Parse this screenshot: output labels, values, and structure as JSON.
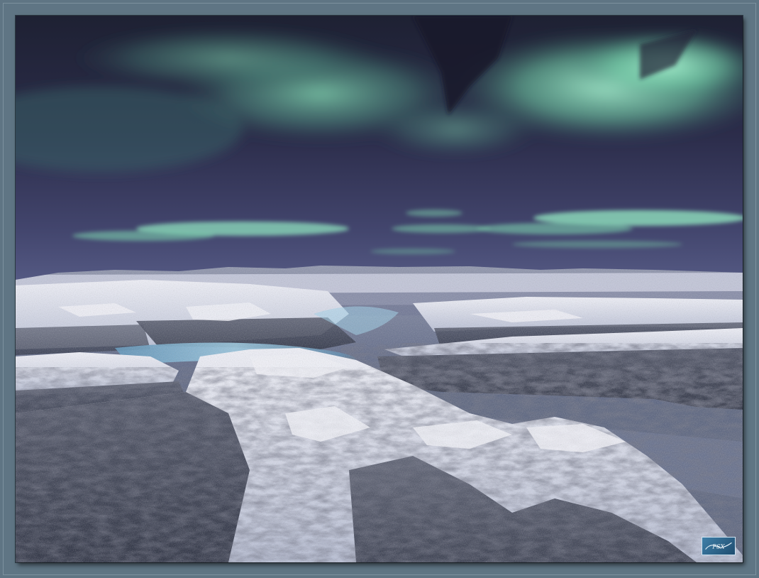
{
  "artwork": {
    "signature": "PSX"
  },
  "colors": {
    "frame": "#5f7584",
    "sky_top": "#22223a",
    "sky_horizon": "#4a4e78",
    "aurora": "#8fe0bd",
    "snow": "#e4e6f2",
    "rock_shadow": "#2a2f3e",
    "ice": "#7fb9d8"
  }
}
